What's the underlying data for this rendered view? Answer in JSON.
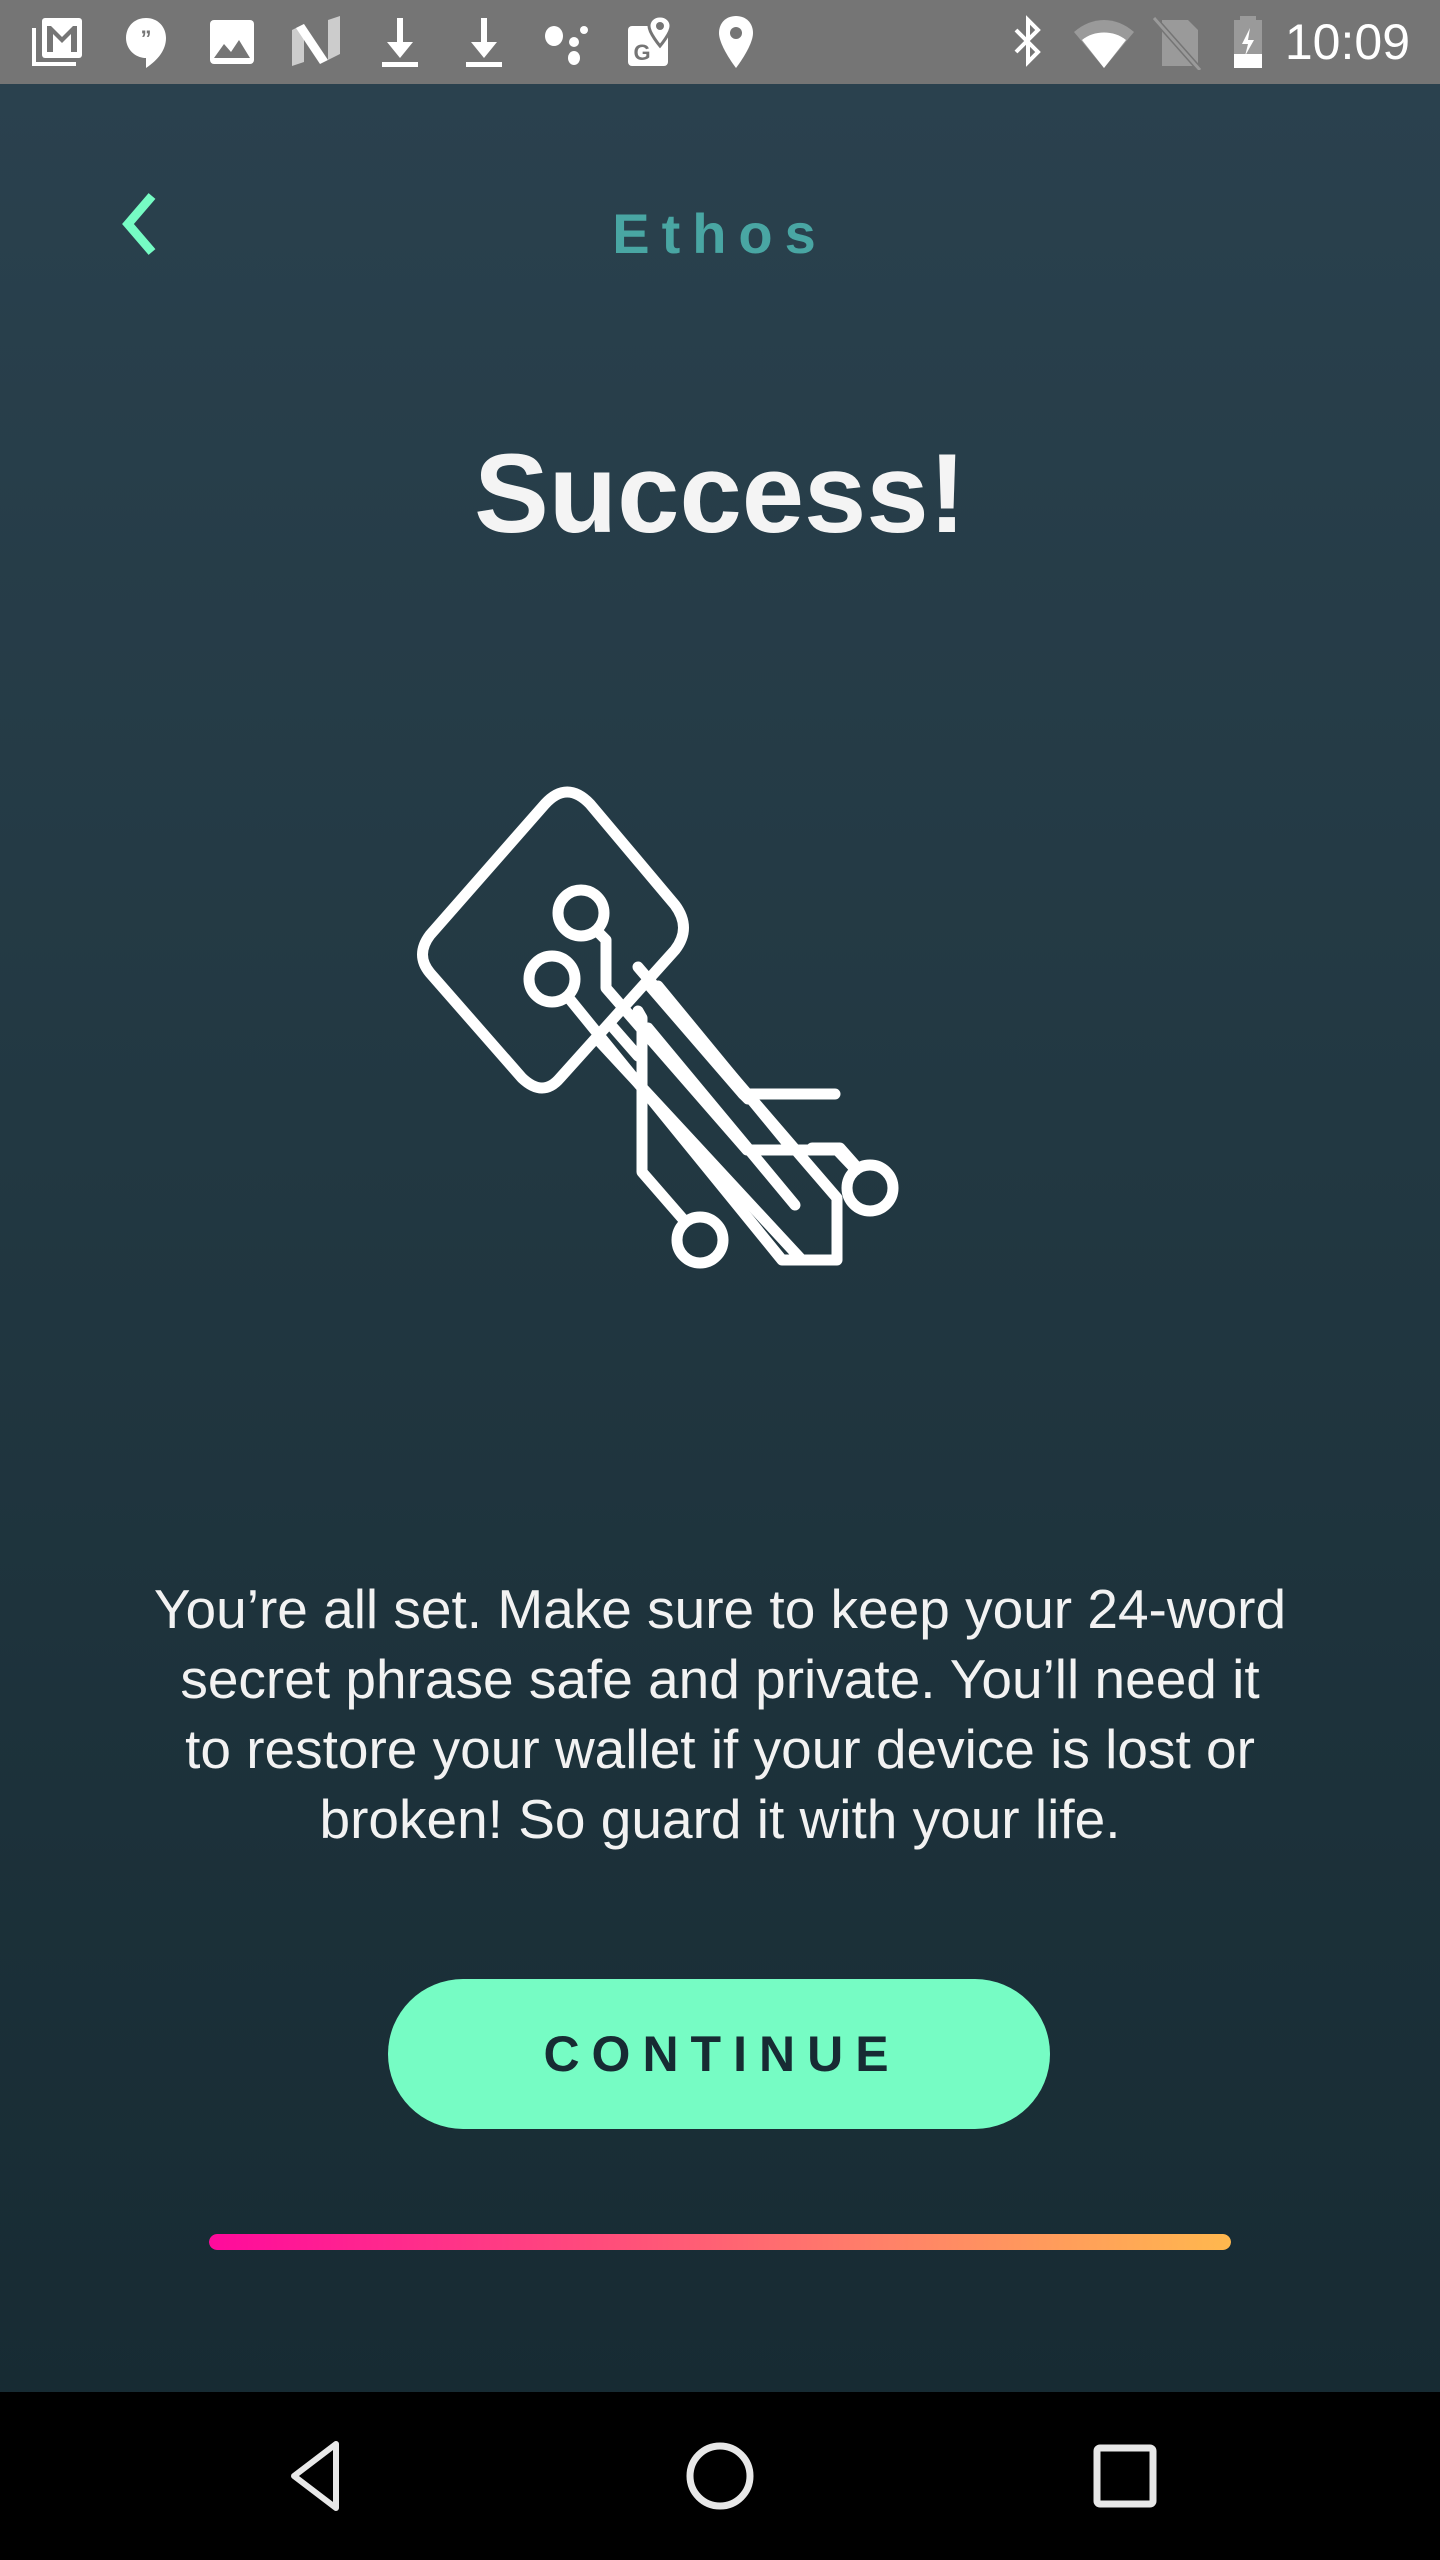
{
  "status_bar": {
    "time": "10:09",
    "left_icons": [
      "gmail-icon",
      "hangouts-icon",
      "photos-icon",
      "n-app-icon",
      "download-icon",
      "download-icon",
      "assistant-dots-icon",
      "google-maps-icon",
      "location-pin-icon"
    ],
    "right_icons": [
      "bluetooth-icon",
      "wifi-icon",
      "no-sim-icon",
      "battery-charging-icon"
    ]
  },
  "header": {
    "back_icon": "chevron-left-icon",
    "app_title": "Ethos"
  },
  "main": {
    "headline": "Success!",
    "illustration": "circuit-key-icon",
    "message": "You’re all set. Make sure to keep your 24-word secret phrase safe and private. You’ll need it to restore your wallet if your device is lost or broken! So guard it with your life.",
    "continue_label": "CONTINUE"
  },
  "progress": {
    "value_percent": 100,
    "gradient_start": "#ff0a9c",
    "gradient_end": "#ffb84e"
  },
  "colors": {
    "accent": "#76fcc4",
    "title": "#49a6a3",
    "background_top": "#2a414e",
    "background_bottom": "#172b33"
  },
  "nav_bar": {
    "buttons": [
      "back-triangle-icon",
      "home-circle-icon",
      "recents-square-icon"
    ]
  }
}
